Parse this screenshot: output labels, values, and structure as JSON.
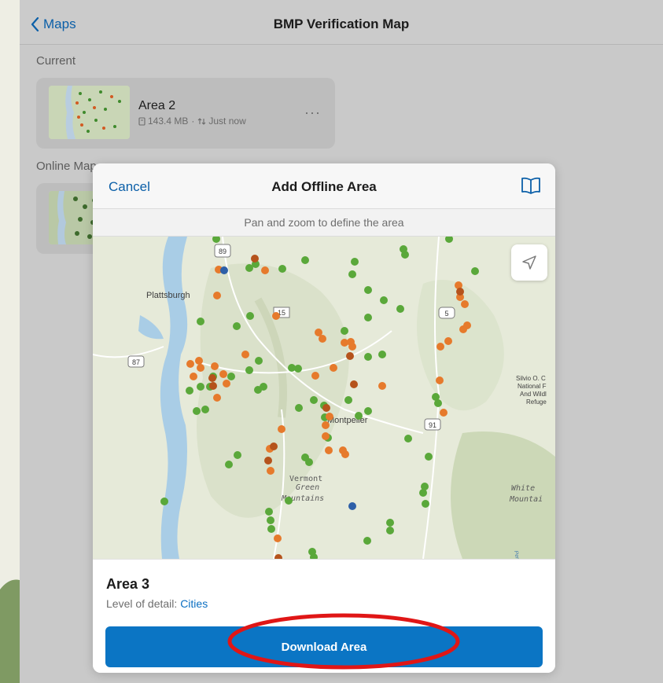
{
  "nav": {
    "back_label": "Maps",
    "title": "BMP Verification Map"
  },
  "sections": {
    "current_label": "Current",
    "online_label": "Online Map"
  },
  "current_map": {
    "name": "Area 2",
    "size": "143.4 MB",
    "separator": "·",
    "sync": "Just now",
    "more": "···"
  },
  "modal": {
    "cancel_label": "Cancel",
    "title": "Add Offline Area",
    "subtitle": "Pan and zoom to define the area",
    "area_name": "Area 3",
    "lod_label": "Level of detail:",
    "lod_value": "Cities",
    "download_label": "Download Area"
  },
  "map_labels": {
    "plattsburgh": "Plattsburgh",
    "montpelier": "Montpelier",
    "vermont": "Vermont",
    "green": "Green",
    "mountains": "Mountains",
    "silvio1": "Silvio O. C",
    "silvio2": "National F",
    "silvio3": "And Wildl",
    "silvio4": "Refuge",
    "white": "White",
    "mountain": "Mountai",
    "pemigewasset": "Pemigewasset R",
    "rt89": "89",
    "rt15": "15",
    "rt5": "5",
    "rt87": "87",
    "rt91": "91"
  },
  "colors": {
    "link_blue": "#0b5fa8",
    "button_blue": "#0b75c4",
    "point_green": "#5aa83a",
    "point_orange": "#e67a2c",
    "point_darkorange": "#b5531c",
    "point_blue": "#2d5fa8",
    "lake_blue": "#a9cde6",
    "highlight_red": "#e01616"
  },
  "icons": {
    "back": "chevron-left-icon",
    "book": "book-icon",
    "locate": "location-arrow-icon",
    "storage": "storage-icon",
    "sync": "sync-arrows-icon"
  }
}
